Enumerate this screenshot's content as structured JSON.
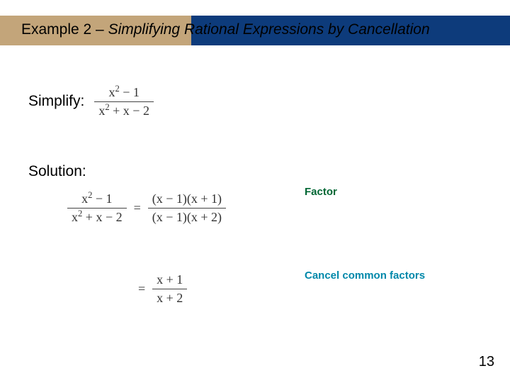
{
  "header": {
    "example_label": "Example 2",
    "separator": " – ",
    "subtitle": "Simplifying Rational Expressions by Cancellation"
  },
  "body": {
    "simplify_label": "Simplify:",
    "simplify_frac_num": "x² − 1",
    "simplify_frac_den": "x² + x − 2",
    "solution_label": "Solution:",
    "step1_lhs_num": "x² − 1",
    "step1_lhs_den": "x² + x − 2",
    "eq": "=",
    "step1_rhs_num": "(x − 1)(x + 1)",
    "step1_rhs_den": "(x − 1)(x + 2)",
    "step2_rhs_num": "x + 1",
    "step2_rhs_den": "x + 2",
    "annot_factor": "Factor",
    "annot_cancel": "Cancel common factors"
  },
  "page_number": "13"
}
